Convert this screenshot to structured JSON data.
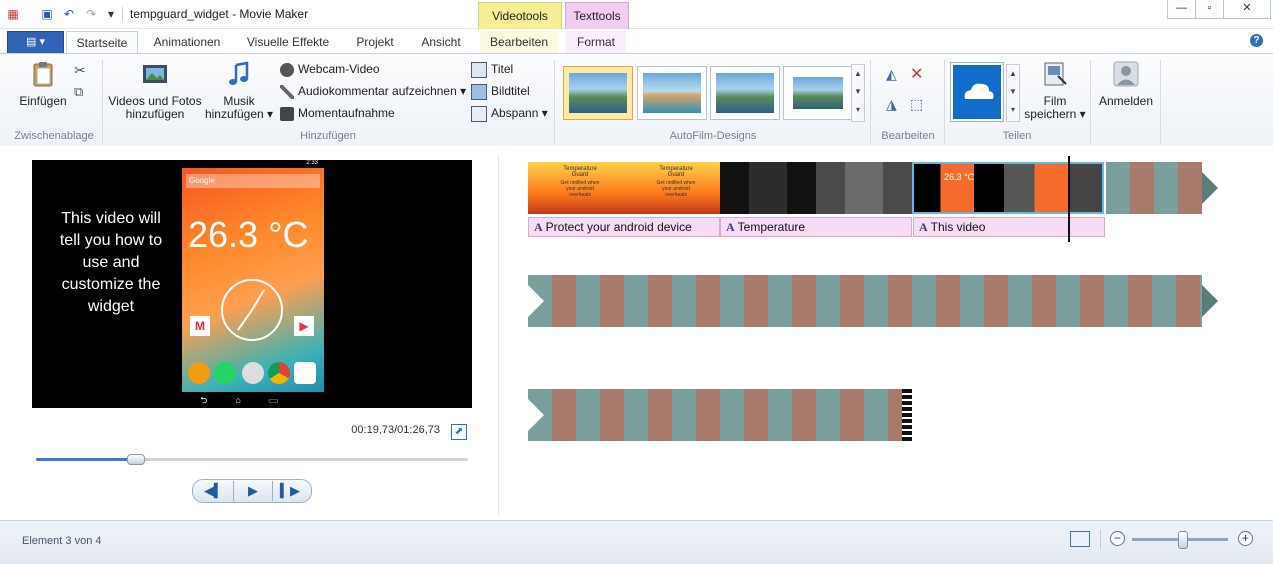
{
  "window": {
    "title": "tempguard_widget - Movie Maker",
    "context_tabs": [
      "Videotools",
      "Texttools"
    ],
    "controls": {
      "minimize": "—",
      "restore": "▫",
      "close": "✕"
    }
  },
  "ribbon_tabs": {
    "file": "▤ ▾",
    "tabs": [
      "Startseite",
      "Animationen",
      "Visuelle Effekte",
      "Projekt",
      "Ansicht",
      "Bearbeiten",
      "Format"
    ],
    "active": "Startseite"
  },
  "ribbon": {
    "clipboard": {
      "paste": "Einfügen",
      "group_label": "Zwischenablage"
    },
    "add": {
      "videos": [
        "Videos und Fotos",
        "hinzufügen"
      ],
      "music": [
        "Musik",
        "hinzufügen ▾"
      ],
      "webcam": "Webcam-Video",
      "narration": "Audiokommentar aufzeichnen ▾",
      "snapshot": "Momentaufnahme",
      "title": "Titel",
      "caption": "Bildtitel",
      "credits": "Abspann ▾",
      "group_label": "Hinzufügen"
    },
    "themes": {
      "group_label": "AutoFilm-Designs"
    },
    "edit": {
      "group_label": "Bearbeiten"
    },
    "share": {
      "save_movie": [
        "Film",
        "speichern ▾"
      ],
      "group_label": "Teilen"
    },
    "signin": "Anmelden"
  },
  "preview": {
    "caption_text": "This video will tell you how to use and customize the widget",
    "phone_search": "Google",
    "phone_clock": "2:33",
    "temperature": "26.3 °C",
    "timecode": "00:19,73/01:26,73",
    "seek_fraction": 0.229
  },
  "storyboard": {
    "captions": [
      "Protect your android device",
      "Temperature",
      "This video"
    ],
    "overlay_text": {
      "tile_title": "Temperature Guard",
      "tile_sub": "Get notified when your android overheats",
      "mini_temp": "26.3 °C"
    }
  },
  "status": {
    "element_text": "Element 3 von 4",
    "zoom_minus": "−",
    "zoom_plus": "+"
  },
  "colors": {
    "accent": "#2f63b5",
    "caption_bg": "#f6dcf5",
    "videotools": "#f4ef96",
    "texttools": "#f1cdf0"
  }
}
